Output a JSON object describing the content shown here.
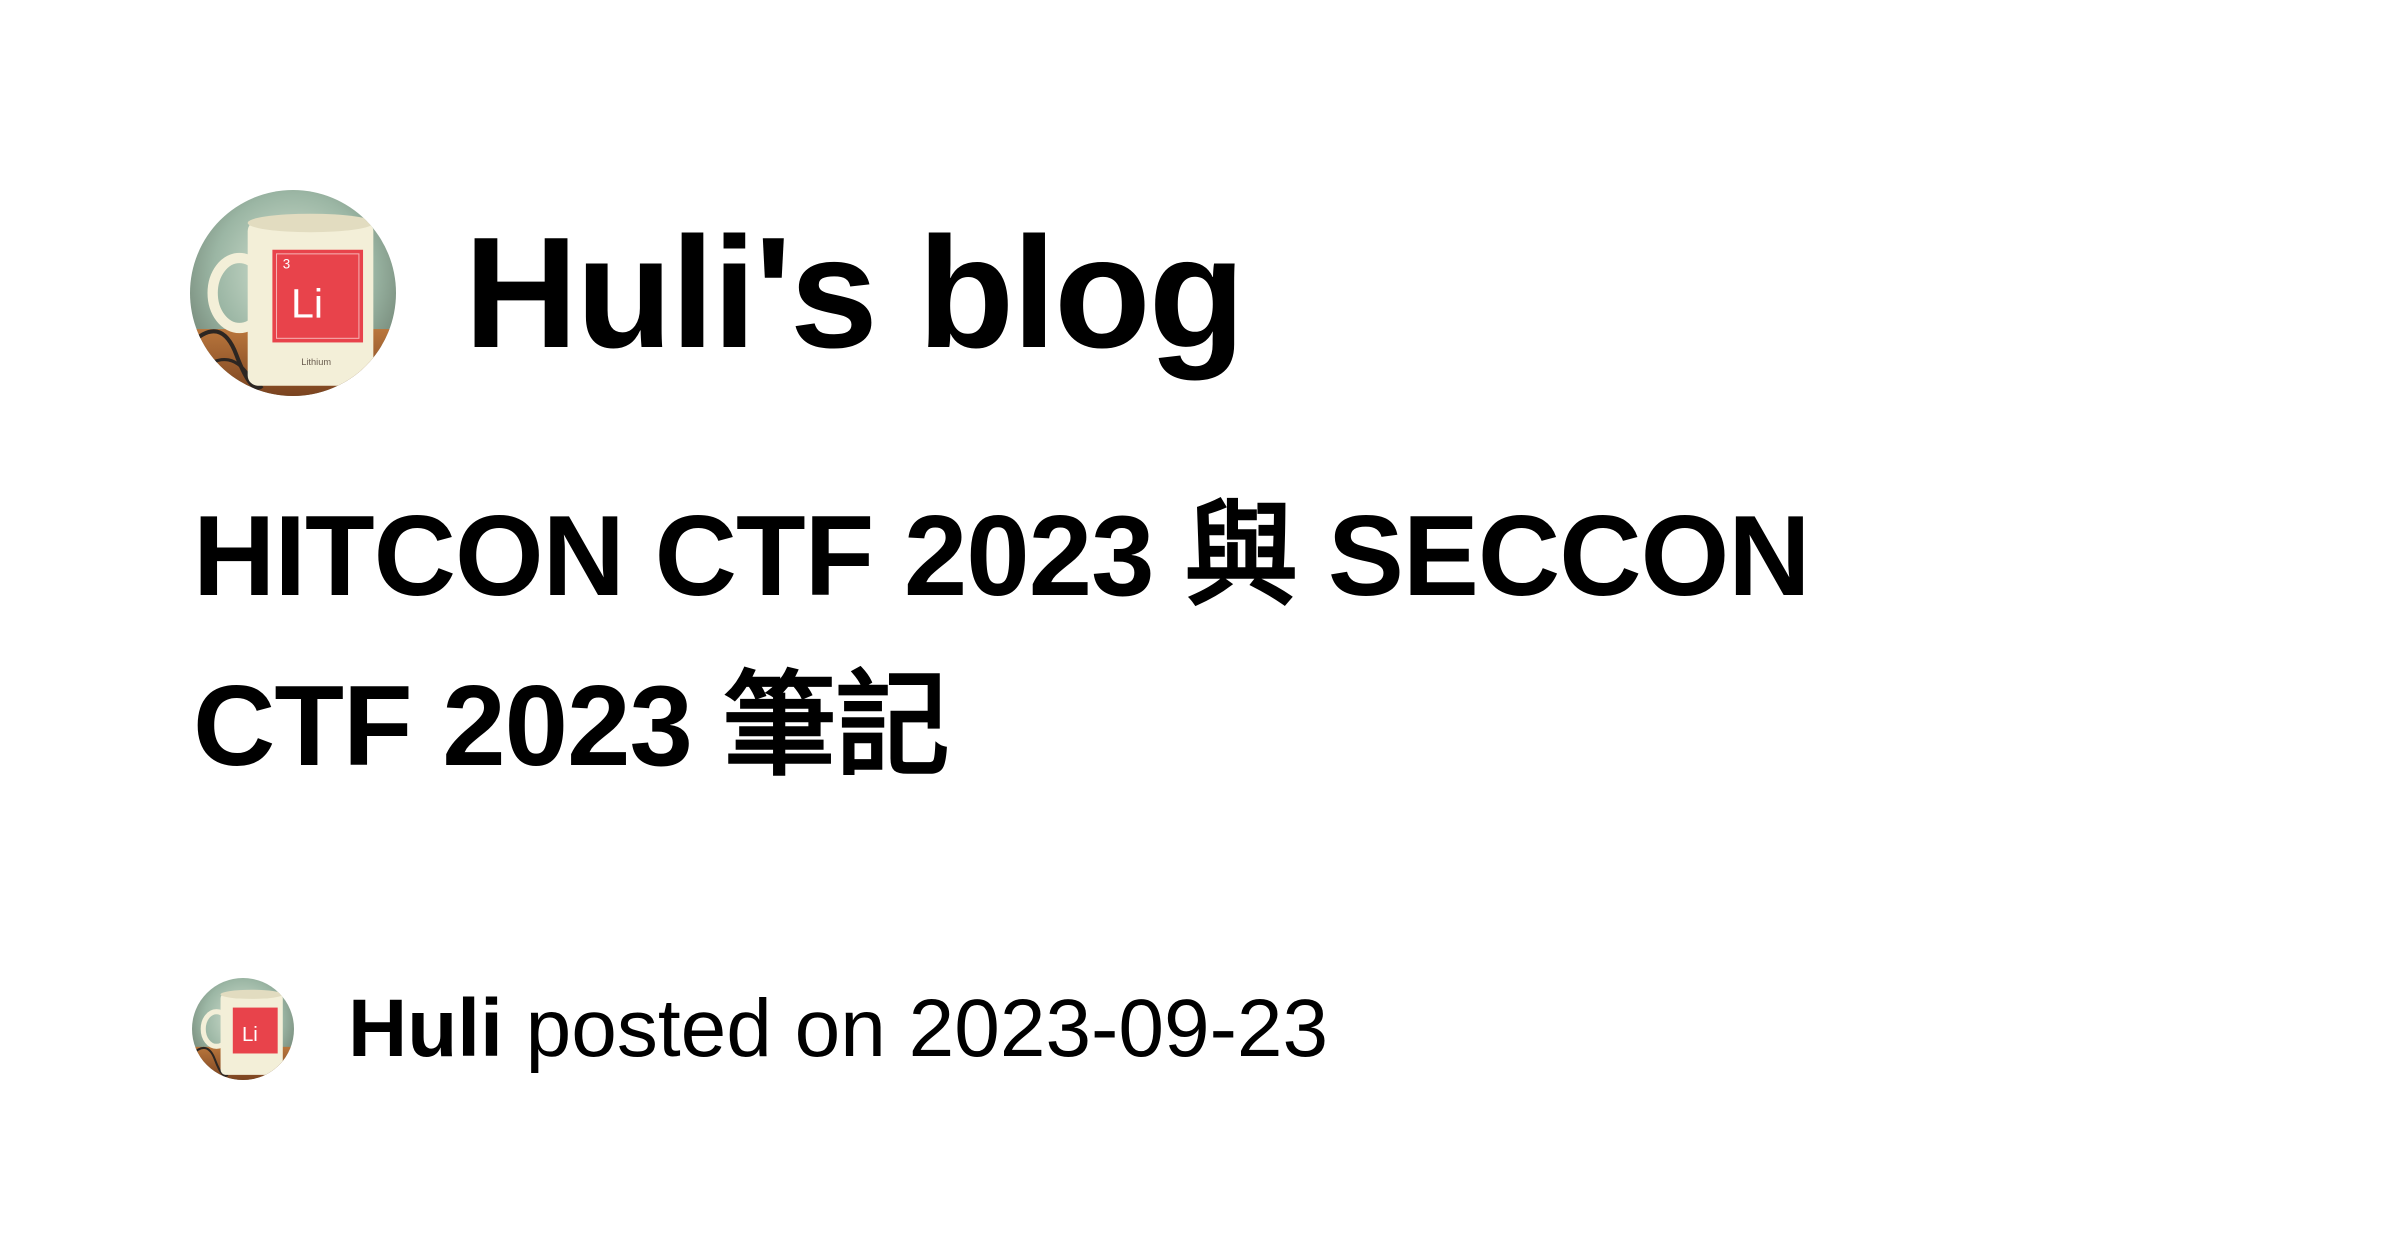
{
  "site": {
    "title": "Huli's blog",
    "avatar_icon": "avatar-lithium-mug-icon",
    "mug_text": "Li",
    "mug_number": "3",
    "mug_caption": "Lithium"
  },
  "post": {
    "title_line1": "HITCON CTF 2023 與 SECCON",
    "title_line2": "CTF 2023 筆記"
  },
  "byline": {
    "author": "Huli",
    "posted_text": " posted on 2023-09-23"
  },
  "colors": {
    "background": "#ffffff",
    "text": "#000000",
    "mug_red": "#e8434b",
    "mug_cream": "#f3efd8"
  }
}
